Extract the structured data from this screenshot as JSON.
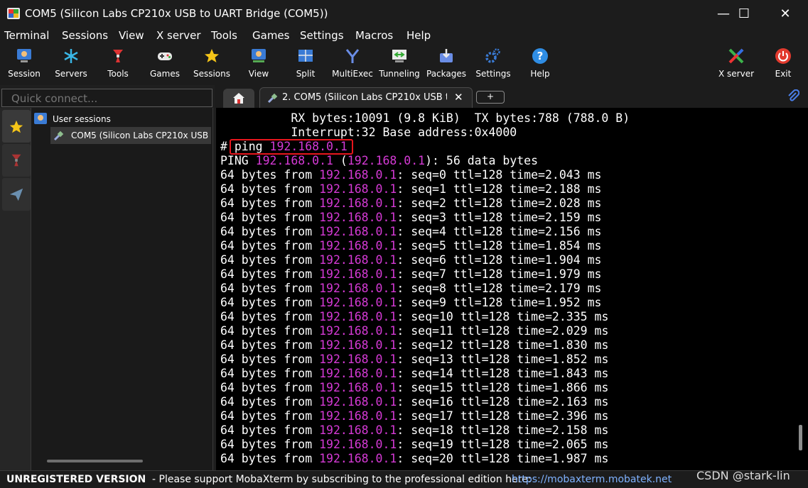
{
  "window": {
    "title": "COM5  (Silicon Labs CP210x USB to UART Bridge (COM5))",
    "minimize_glyph": "—",
    "maximize_glyph": "☐",
    "close_glyph": "✕"
  },
  "menu": [
    "Terminal",
    "Sessions",
    "View",
    "X server",
    "Tools",
    "Games",
    "Settings",
    "Macros",
    "Help"
  ],
  "toolbar": {
    "items": [
      {
        "label": "Session",
        "icon": "session-icon"
      },
      {
        "label": "Servers",
        "icon": "servers-icon"
      },
      {
        "label": "Tools",
        "icon": "tools-icon"
      },
      {
        "label": "Games",
        "icon": "games-icon"
      },
      {
        "label": "Sessions",
        "icon": "sessions-star-icon"
      },
      {
        "label": "View",
        "icon": "view-icon"
      },
      {
        "label": "Split",
        "icon": "split-icon"
      },
      {
        "label": "MultiExec",
        "icon": "multiexec-icon"
      },
      {
        "label": "Tunneling",
        "icon": "tunneling-icon"
      },
      {
        "label": "Packages",
        "icon": "packages-icon"
      },
      {
        "label": "Settings",
        "icon": "settings-icon"
      },
      {
        "label": "Help",
        "icon": "help-icon"
      }
    ],
    "right_items": [
      {
        "label": "X server",
        "icon": "xserver-icon"
      },
      {
        "label": "Exit",
        "icon": "exit-icon"
      }
    ]
  },
  "quick_connect": {
    "placeholder": "Quick connect..."
  },
  "tabs": {
    "home_icon": "home-icon",
    "active_tab_label": "2. COM5  (Silicon Labs CP210x USB to UART Bridge (COM5))",
    "close_glyph": "✕",
    "new_tab_glyph": "+"
  },
  "sidebar": {
    "tree_root": "User sessions",
    "tree_item": "COM5  (Silicon Labs CP210x USB to UART Bridge (COM5))"
  },
  "terminal": {
    "lines": [
      [
        {
          "t": "          RX bytes:10091 (9.8 KiB)  TX bytes:788 (788.0 B)"
        }
      ],
      [
        {
          "t": "          Interrupt:32 Base address:0x4000"
        }
      ],
      [
        {
          "t": "# ping "
        },
        {
          "t": "192.168.0.1",
          "c": "mag"
        }
      ],
      [
        {
          "t": "PING "
        },
        {
          "t": "192.168.0.1",
          "c": "mag"
        },
        {
          "t": " ("
        },
        {
          "t": "192.168.0.1",
          "c": "mag"
        },
        {
          "t": "): 56 data bytes"
        }
      ],
      [
        {
          "t": "64 bytes from "
        },
        {
          "t": "192.168.0.1",
          "c": "mag"
        },
        {
          "t": ": seq=0 ttl=128 time=2.043 ms"
        }
      ],
      [
        {
          "t": "64 bytes from "
        },
        {
          "t": "192.168.0.1",
          "c": "mag"
        },
        {
          "t": ": seq=1 ttl=128 time=2.188 ms"
        }
      ],
      [
        {
          "t": "64 bytes from "
        },
        {
          "t": "192.168.0.1",
          "c": "mag"
        },
        {
          "t": ": seq=2 ttl=128 time=2.028 ms"
        }
      ],
      [
        {
          "t": "64 bytes from "
        },
        {
          "t": "192.168.0.1",
          "c": "mag"
        },
        {
          "t": ": seq=3 ttl=128 time=2.159 ms"
        }
      ],
      [
        {
          "t": "64 bytes from "
        },
        {
          "t": "192.168.0.1",
          "c": "mag"
        },
        {
          "t": ": seq=4 ttl=128 time=2.156 ms"
        }
      ],
      [
        {
          "t": "64 bytes from "
        },
        {
          "t": "192.168.0.1",
          "c": "mag"
        },
        {
          "t": ": seq=5 ttl=128 time=1.854 ms"
        }
      ],
      [
        {
          "t": "64 bytes from "
        },
        {
          "t": "192.168.0.1",
          "c": "mag"
        },
        {
          "t": ": seq=6 ttl=128 time=1.904 ms"
        }
      ],
      [
        {
          "t": "64 bytes from "
        },
        {
          "t": "192.168.0.1",
          "c": "mag"
        },
        {
          "t": ": seq=7 ttl=128 time=1.979 ms"
        }
      ],
      [
        {
          "t": "64 bytes from "
        },
        {
          "t": "192.168.0.1",
          "c": "mag"
        },
        {
          "t": ": seq=8 ttl=128 time=2.179 ms"
        }
      ],
      [
        {
          "t": "64 bytes from "
        },
        {
          "t": "192.168.0.1",
          "c": "mag"
        },
        {
          "t": ": seq=9 ttl=128 time=1.952 ms"
        }
      ],
      [
        {
          "t": "64 bytes from "
        },
        {
          "t": "192.168.0.1",
          "c": "mag"
        },
        {
          "t": ": seq=10 ttl=128 time=2.335 ms"
        }
      ],
      [
        {
          "t": "64 bytes from "
        },
        {
          "t": "192.168.0.1",
          "c": "mag"
        },
        {
          "t": ": seq=11 ttl=128 time=2.029 ms"
        }
      ],
      [
        {
          "t": "64 bytes from "
        },
        {
          "t": "192.168.0.1",
          "c": "mag"
        },
        {
          "t": ": seq=12 ttl=128 time=1.830 ms"
        }
      ],
      [
        {
          "t": "64 bytes from "
        },
        {
          "t": "192.168.0.1",
          "c": "mag"
        },
        {
          "t": ": seq=13 ttl=128 time=1.852 ms"
        }
      ],
      [
        {
          "t": "64 bytes from "
        },
        {
          "t": "192.168.0.1",
          "c": "mag"
        },
        {
          "t": ": seq=14 ttl=128 time=1.843 ms"
        }
      ],
      [
        {
          "t": "64 bytes from "
        },
        {
          "t": "192.168.0.1",
          "c": "mag"
        },
        {
          "t": ": seq=15 ttl=128 time=1.866 ms"
        }
      ],
      [
        {
          "t": "64 bytes from "
        },
        {
          "t": "192.168.0.1",
          "c": "mag"
        },
        {
          "t": ": seq=16 ttl=128 time=2.163 ms"
        }
      ],
      [
        {
          "t": "64 bytes from "
        },
        {
          "t": "192.168.0.1",
          "c": "mag"
        },
        {
          "t": ": seq=17 ttl=128 time=2.396 ms"
        }
      ],
      [
        {
          "t": "64 bytes from "
        },
        {
          "t": "192.168.0.1",
          "c": "mag"
        },
        {
          "t": ": seq=18 ttl=128 time=2.158 ms"
        }
      ],
      [
        {
          "t": "64 bytes from "
        },
        {
          "t": "192.168.0.1",
          "c": "mag"
        },
        {
          "t": ": seq=19 ttl=128 time=2.065 ms"
        }
      ],
      [
        {
          "t": "64 bytes from "
        },
        {
          "t": "192.168.0.1",
          "c": "mag"
        },
        {
          "t": ": seq=20 ttl=128 time=1.987 ms"
        }
      ]
    ]
  },
  "status": {
    "unregistered": "UNREGISTERED VERSION",
    "message": "-  Please support MobaXterm by subscribing to the professional edition here:",
    "link": "https://mobaxterm.mobatek.net"
  },
  "watermark": "CSDN @stark-lin",
  "colors": {
    "terminal_bg": "#000000",
    "terminal_fg": "#ffffff",
    "ip_highlight": "#d63ad6",
    "command_box": "#e8161d",
    "link": "#7fb2ff"
  }
}
